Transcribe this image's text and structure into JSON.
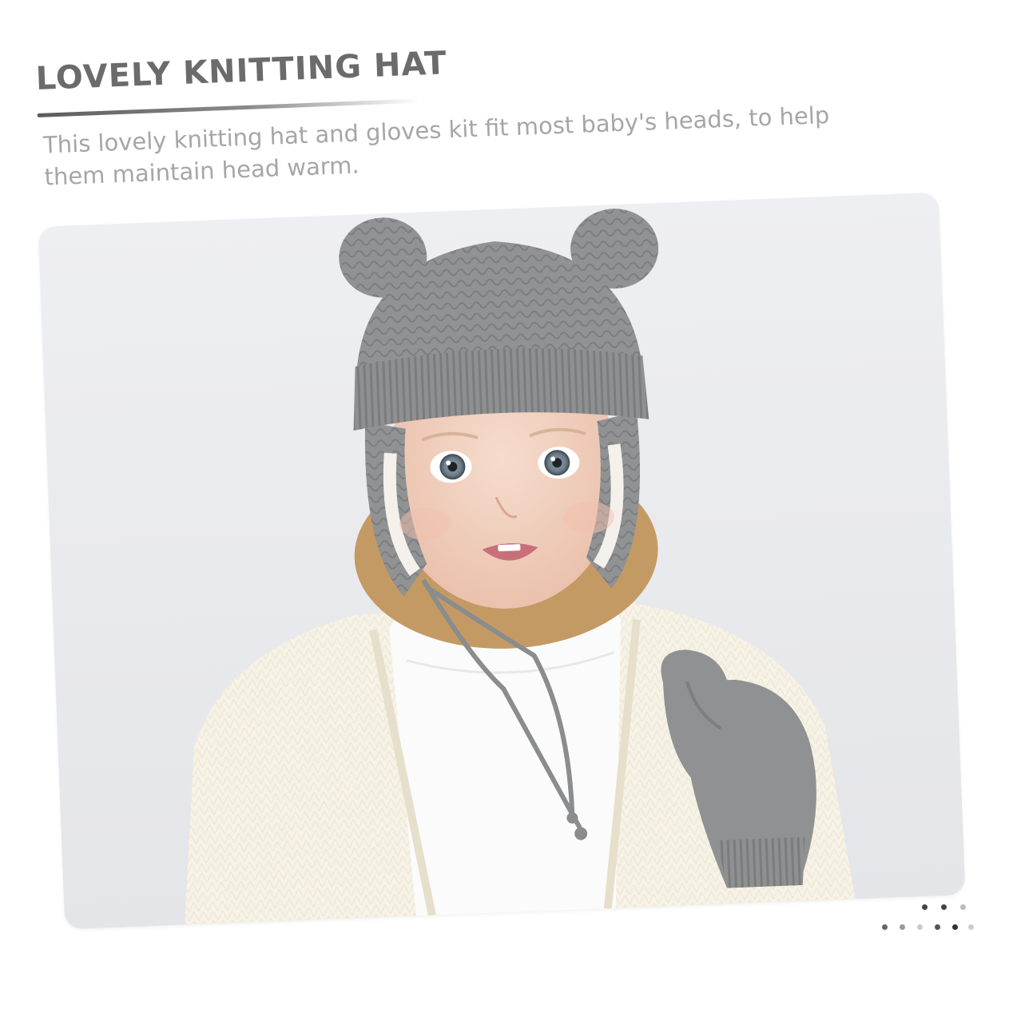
{
  "header": {
    "title": "LOVELY KNITTING HAT",
    "description": "This lovely knitting hat and gloves kit fit most baby's heads, to help them maintain head warm."
  },
  "photo": {
    "subject": "child-in-knit-hat-and-mitten"
  },
  "colors": {
    "title": "#6b6b6b",
    "description": "#a6a6a6",
    "knit_gray": "#8f9192",
    "sweater_cream": "#f6f2e6",
    "background": "#e9eaed"
  },
  "pagination": {
    "dot_colors": [
      "#444444",
      "#444444",
      "#bbbbbb",
      "#666666",
      "#999999",
      "#333333",
      "#444444",
      "#555555",
      "#cccccc",
      "#555555",
      "#cccccc"
    ]
  }
}
